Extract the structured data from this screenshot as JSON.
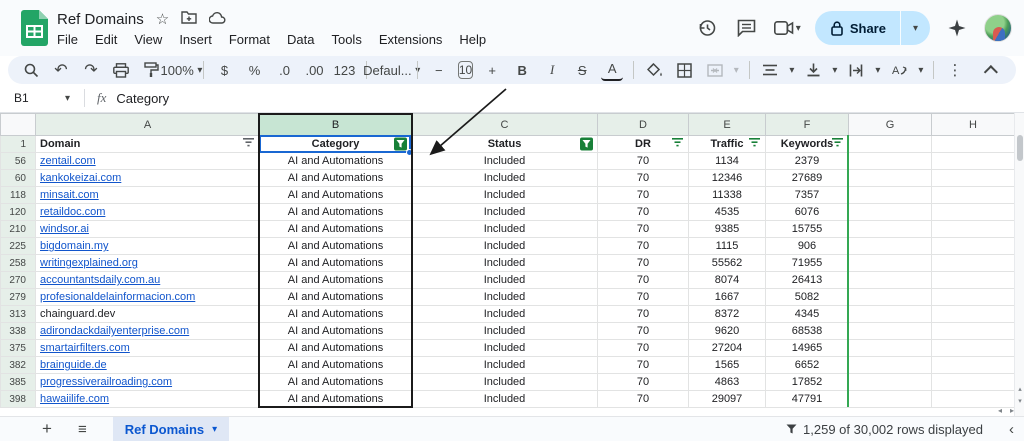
{
  "appbar": {
    "title": "Ref Domains",
    "menus": [
      "File",
      "Edit",
      "View",
      "Insert",
      "Format",
      "Data",
      "Tools",
      "Extensions",
      "Help"
    ],
    "share_label": "Share"
  },
  "toolbar": {
    "zoom_level": "100%",
    "currency": "$",
    "percent": "%",
    "decrease_decimal": ".0",
    "increase_decimal": ".00",
    "more_formats": "123",
    "font_family": "Defaul...",
    "font_size": "10",
    "minus": "−",
    "plus": "+",
    "bold": "B",
    "italic": "I",
    "strikethrough": "S",
    "text_color": "A"
  },
  "formula_bar": {
    "name_box": "B1",
    "value": "Category"
  },
  "grid": {
    "columns": [
      "A",
      "B",
      "C",
      "D",
      "E",
      "F",
      "G",
      "H"
    ],
    "header": {
      "domain": "Domain",
      "category": "Category",
      "status": "Status",
      "dr": "DR",
      "traffic": "Traffic",
      "keywords": "Keywords"
    },
    "rows": [
      {
        "n": "56",
        "domain": "zentail.com",
        "link": true,
        "category": "AI and Automations",
        "status": "Included",
        "dr": "70",
        "traffic": "1134",
        "keywords": "2379"
      },
      {
        "n": "60",
        "domain": "kankokeizai.com",
        "link": true,
        "category": "AI and Automations",
        "status": "Included",
        "dr": "70",
        "traffic": "12346",
        "keywords": "27689"
      },
      {
        "n": "118",
        "domain": "minsait.com",
        "link": true,
        "category": "AI and Automations",
        "status": "Included",
        "dr": "70",
        "traffic": "11338",
        "keywords": "7357"
      },
      {
        "n": "120",
        "domain": "retaildoc.com",
        "link": true,
        "category": "AI and Automations",
        "status": "Included",
        "dr": "70",
        "traffic": "4535",
        "keywords": "6076"
      },
      {
        "n": "210",
        "domain": "windsor.ai",
        "link": true,
        "category": "AI and Automations",
        "status": "Included",
        "dr": "70",
        "traffic": "9385",
        "keywords": "15755"
      },
      {
        "n": "225",
        "domain": "bigdomain.my",
        "link": true,
        "category": "AI and Automations",
        "status": "Included",
        "dr": "70",
        "traffic": "1115",
        "keywords": "906"
      },
      {
        "n": "258",
        "domain": "writingexplained.org",
        "link": true,
        "category": "AI and Automations",
        "status": "Included",
        "dr": "70",
        "traffic": "55562",
        "keywords": "71955"
      },
      {
        "n": "270",
        "domain": "accountantsdaily.com.au",
        "link": true,
        "category": "AI and Automations",
        "status": "Included",
        "dr": "70",
        "traffic": "8074",
        "keywords": "26413"
      },
      {
        "n": "279",
        "domain": "profesionaldelainformacion.com",
        "link": true,
        "category": "AI and Automations",
        "status": "Included",
        "dr": "70",
        "traffic": "1667",
        "keywords": "5082"
      },
      {
        "n": "313",
        "domain": "chainguard.dev",
        "link": false,
        "category": "AI and Automations",
        "status": "Included",
        "dr": "70",
        "traffic": "8372",
        "keywords": "4345"
      },
      {
        "n": "338",
        "domain": "adirondackdailyenterprise.com",
        "link": true,
        "category": "AI and Automations",
        "status": "Included",
        "dr": "70",
        "traffic": "9620",
        "keywords": "68538"
      },
      {
        "n": "375",
        "domain": "smartairfilters.com",
        "link": true,
        "category": "AI and Automations",
        "status": "Included",
        "dr": "70",
        "traffic": "27204",
        "keywords": "14965"
      },
      {
        "n": "382",
        "domain": "brainguide.de",
        "link": true,
        "category": "AI and Automations",
        "status": "Included",
        "dr": "70",
        "traffic": "1565",
        "keywords": "6652"
      },
      {
        "n": "385",
        "domain": "progressiverailroading.com",
        "link": true,
        "category": "AI and Automations",
        "status": "Included",
        "dr": "70",
        "traffic": "4863",
        "keywords": "17852"
      },
      {
        "n": "398",
        "domain": "hawaiilife.com",
        "link": true,
        "category": "AI and Automations",
        "status": "Included",
        "dr": "70",
        "traffic": "29097",
        "keywords": "47791"
      }
    ]
  },
  "sheet_bar": {
    "tab_label": "Ref Domains"
  },
  "status_bar": {
    "rows_displayed": "1,259 of 30,002 rows displayed"
  },
  "icons": {
    "star": "☆",
    "dropdown": "▾",
    "undo": "↶",
    "redo": "↷",
    "more_vertical": "⋮",
    "all_sheets": "≡",
    "add_sheet": "+",
    "panel_chevron": "‹",
    "scroll_left": "◂",
    "scroll_right": "▸",
    "scroll_up": "▴",
    "scroll_down": "▾"
  },
  "colors": {
    "selection_blue": "#1967d2",
    "link_blue": "#1155cc",
    "filter_green": "#188038",
    "range_green": "#34a853",
    "share_bg": "#c2e7ff",
    "tab_bg": "#dfe7f5",
    "tab_text": "#0b57d0",
    "filtered_header_green": "#e6efe9",
    "selected_header_green": "#c7e5d3",
    "toolbar_bg": "#edf2fa"
  }
}
